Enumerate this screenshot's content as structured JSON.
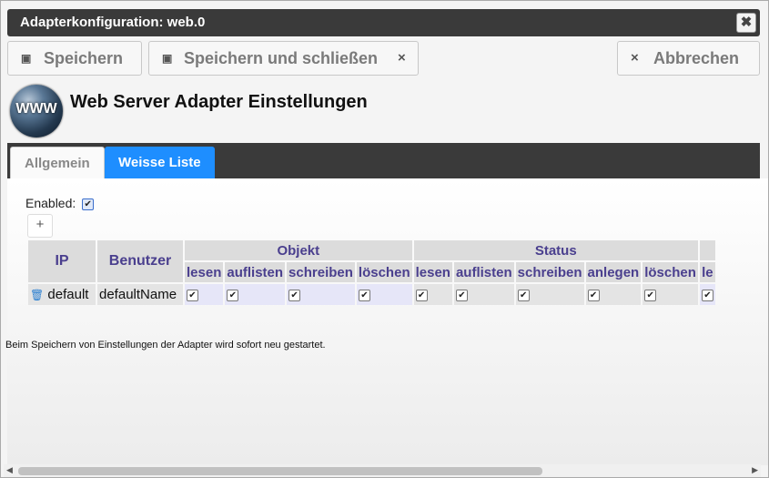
{
  "dialog": {
    "title": "Adapterkonfiguration: web.0",
    "close_glyph": "✖"
  },
  "toolbar": {
    "save": "Speichern",
    "save_close": "Speichern und schließen",
    "save_close_icon": "×",
    "cancel": "Abbrechen",
    "cancel_icon": "×",
    "save_icon": "▣"
  },
  "header": {
    "logo_text": "WWW",
    "title": "Web Server Adapter Einstellungen"
  },
  "tabs": [
    {
      "label": "Allgemein",
      "active": false
    },
    {
      "label": "Weisse Liste",
      "active": true
    }
  ],
  "form": {
    "enabled_label": "Enabled:",
    "enabled": true,
    "add_glyph": "+"
  },
  "table": {
    "col_ip": "IP",
    "col_user": "Benutzer",
    "group_objekt": "Objekt",
    "group_status": "Status",
    "group_cut": "le",
    "objekt_cols": [
      "lesen",
      "auflisten",
      "schreiben",
      "löschen"
    ],
    "status_cols": [
      "lesen",
      "auflisten",
      "schreiben",
      "anlegen",
      "löschen"
    ],
    "rows": [
      {
        "ip": "default",
        "user": "defaultName",
        "checks": [
          true,
          true,
          true,
          true,
          true,
          true,
          true,
          true,
          true,
          true
        ]
      }
    ]
  },
  "note": "Beim Speichern von Einstellungen der Adapter wird sofort neu gestartet.",
  "colors": {
    "accent": "#1e8eff",
    "header_text": "#4a3f8e",
    "bar": "#3a3a3a"
  }
}
